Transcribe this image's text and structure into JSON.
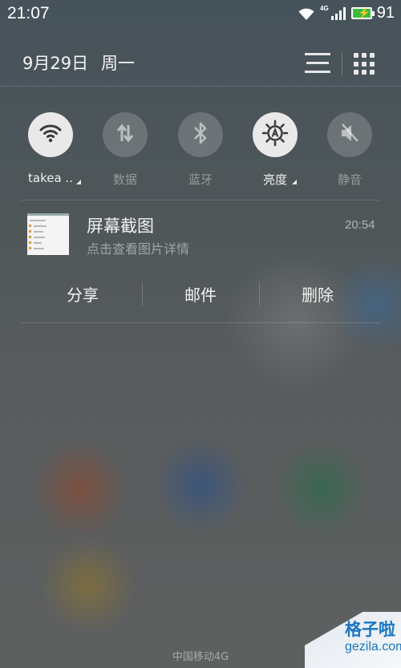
{
  "status_bar": {
    "time": "21:07",
    "network_tag": "4G",
    "battery_level": "91",
    "icons": [
      "wifi-icon",
      "signal-icon",
      "battery-charging-icon"
    ]
  },
  "header": {
    "date": "9月29日",
    "weekday": "周一",
    "buttons": [
      "list-icon",
      "grid-icon"
    ]
  },
  "quick_toggles": [
    {
      "label": "takea ..",
      "icon": "wifi-icon",
      "state": "on",
      "has_menu": true
    },
    {
      "label": "数据",
      "icon": "data-transfer-icon",
      "state": "off",
      "has_menu": false
    },
    {
      "label": "蓝牙",
      "icon": "bluetooth-icon",
      "state": "off",
      "has_menu": false
    },
    {
      "label": "亮度",
      "icon": "auto-brightness-icon",
      "state": "on",
      "has_menu": true
    },
    {
      "label": "静音",
      "icon": "mute-icon",
      "state": "off",
      "has_menu": false
    }
  ],
  "notification": {
    "title": "屏幕截图",
    "subtitle": "点击查看图片详情",
    "time": "20:54",
    "actions": [
      "分享",
      "邮件",
      "删除"
    ]
  },
  "footer": {
    "carrier": "中国移动4G"
  },
  "watermark": {
    "title": "格子啦",
    "url": "gezila.com"
  },
  "colors": {
    "toggle_on": "#e9e9e9",
    "battery": "#3dbb3d",
    "watermark": "#1a76c2"
  }
}
